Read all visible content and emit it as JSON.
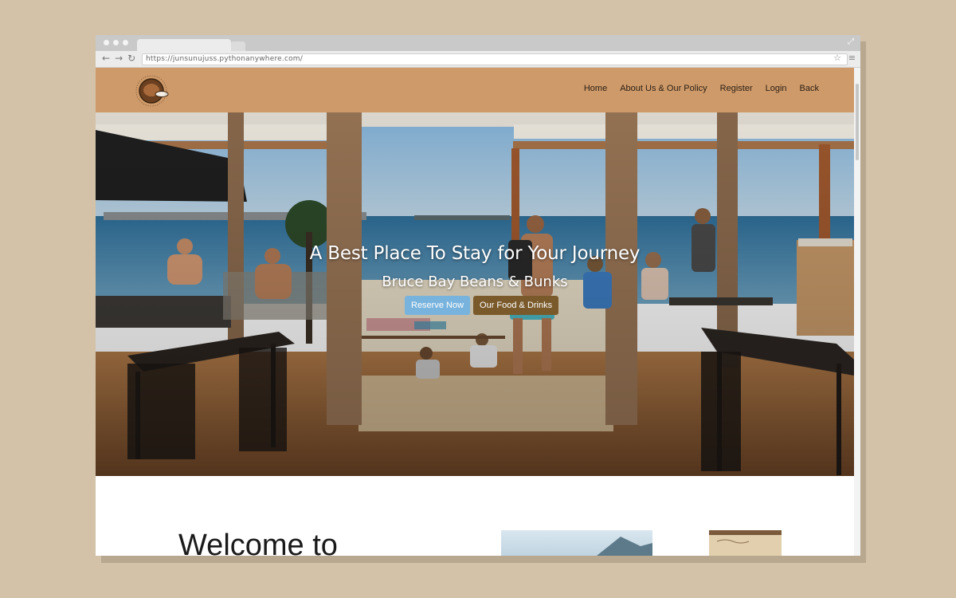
{
  "browser": {
    "url": "https://junsunujuss.pythonanywhere.com/"
  },
  "icons": {
    "back": "arrow-left-icon",
    "forward": "arrow-right-icon",
    "reload": "reload-icon",
    "bookmark": "star-icon",
    "menu": "hamburger-menu-icon",
    "expand": "expand-icon"
  },
  "nav": {
    "items": [
      "Home",
      "About Us & Our Policy",
      "Register",
      "Login",
      "Back"
    ]
  },
  "hero": {
    "title": "A Best Place To Stay for Your Journey",
    "subtitle": "Bruce Bay Beans & Bunks",
    "reserve_label": "Reserve Now",
    "food_label": "Our Food & Drinks"
  },
  "section": {
    "welcome": "Welcome to"
  },
  "colors": {
    "nav_bg": "#cf9a69",
    "reserve_btn": "#78b3dd",
    "food_btn": "#7a5a2b",
    "backdrop": "#d3c2a8"
  }
}
